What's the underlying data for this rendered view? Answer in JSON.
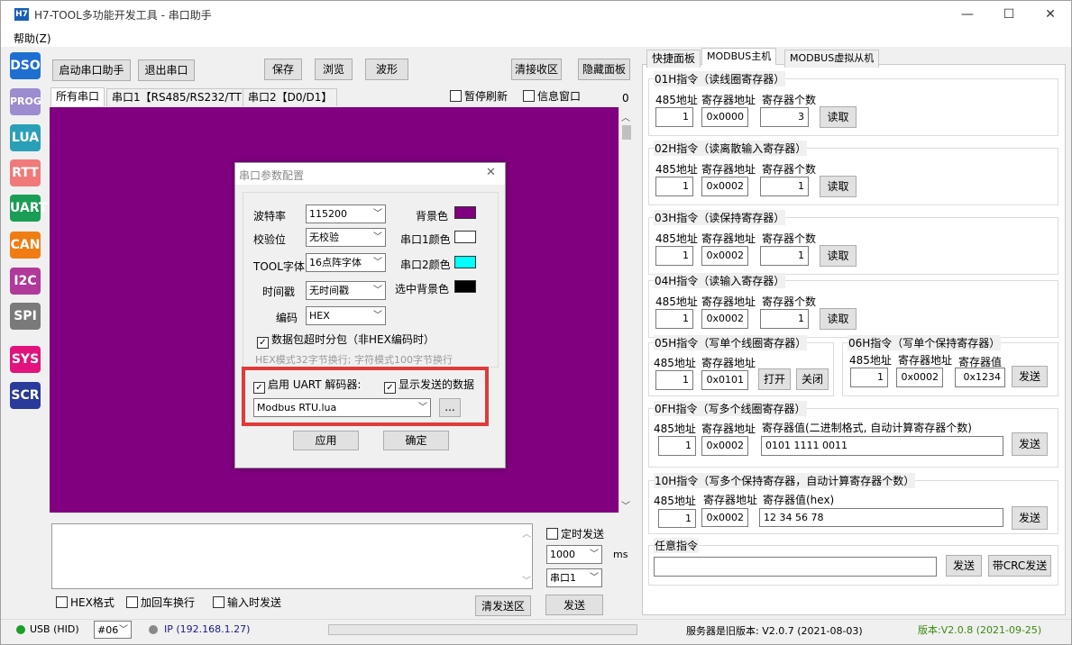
{
  "window": {
    "app_icon": "H7",
    "title": "H7-TOOL多功能开发工具 - 串口助手",
    "minimize": "—",
    "maximize": "☐",
    "close": "✕"
  },
  "menu": {
    "help": "帮助(Z)"
  },
  "sidebar": [
    {
      "label": "DSO",
      "color": "#1f6fd1"
    },
    {
      "label": "PROG",
      "color": "#9d8ccf"
    },
    {
      "label": "LUA",
      "color": "#2aa0b8"
    },
    {
      "label": "RTT",
      "color": "#f07a7a"
    },
    {
      "label": "UART",
      "color": "#1a9e55"
    },
    {
      "label": "CAN",
      "color": "#f07d14"
    },
    {
      "label": "I2C",
      "color": "#b03a9a"
    },
    {
      "label": "SPI",
      "color": "#7a7a7a"
    },
    {
      "label": "SYS",
      "color": "#e0147c"
    },
    {
      "label": "SCR",
      "color": "#2a3a9a"
    }
  ],
  "toolbar": {
    "start": "启动串口助手",
    "exit": "退出串口",
    "save": "保存",
    "browse": "浏览",
    "wave": "波形",
    "clear_recv": "清接收区",
    "hide_panel": "隐藏面板"
  },
  "serial_tabs": [
    "所有串口",
    "串口1【RS485/RS232/TTL】",
    "串口2【D0/D1】"
  ],
  "pause_refresh": "暂停刷新",
  "info_window": "信息窗口",
  "recv_count": "0",
  "colors": {
    "bg": "#800080",
    "port1": "#ffffff",
    "port2": "#00ffff",
    "sel_bg": "#000000"
  },
  "dialog": {
    "title": "串口参数配置",
    "close": "✕",
    "baud_label": "波特率",
    "baud": "115200",
    "parity_label": "校验位",
    "parity": "无校验",
    "font_label": "TOOL字体",
    "font": "16点阵字体",
    "timestamp_label": "时间戳",
    "timestamp": "无时间戳",
    "encoding_label": "编码",
    "encoding": "HEX",
    "bg_label": "背景色",
    "port1_label": "串口1颜色",
    "port2_label": "串口2颜色",
    "selbg_label": "选中背景色",
    "packet_split": "数据包超时分包（非HEX编码时）",
    "hint": "HEX模式32字节换行; 字符模式100字节换行",
    "uart_decoder": "启用 UART 解码器:",
    "show_sent": "显示发送的数据",
    "decoder_file": "Modbus RTU.lua",
    "browse": "...",
    "apply": "应用",
    "ok": "确定"
  },
  "send_area": {
    "timed_send": "定时发送",
    "interval": "1000",
    "unit": "ms",
    "port": "串口1",
    "hex_format": "HEX格式",
    "add_crlf": "加回车换行",
    "send_on_input": "输入时发送",
    "clear_send": "清发送区",
    "send": "发送"
  },
  "right_tabs": [
    "快捷面板",
    "MODBUS主机",
    "MODBUS虚拟从机"
  ],
  "modbus": {
    "addr": "485地址",
    "reg_addr": "寄存器地址",
    "reg_count": "寄存器个数",
    "reg_val": "寄存器值",
    "read": "读取",
    "send": "发送",
    "open": "打开",
    "close": "关闭",
    "g01": {
      "title": "01H指令（读线圈寄存器）",
      "a": "1",
      "r": "0x0000",
      "c": "3"
    },
    "g02": {
      "title": "02H指令（读离散输入寄存器）",
      "a": "1",
      "r": "0x0002",
      "c": "1"
    },
    "g03": {
      "title": "03H指令（读保持寄存器）",
      "a": "1",
      "r": "0x0002",
      "c": "1"
    },
    "g04": {
      "title": "04H指令（读输入寄存器）",
      "a": "1",
      "r": "0x0002",
      "c": "1"
    },
    "g05": {
      "title": "05H指令（写单个线圈寄存器）",
      "a": "1",
      "r": "0x0101"
    },
    "g06": {
      "title": "06H指令（写单个保持寄存器）",
      "a": "1",
      "r": "0x0002",
      "v": "0x1234"
    },
    "g0f": {
      "title": "0FH指令（写多个线圈寄存器）",
      "a": "1",
      "r": "0x0002",
      "vlabel": "寄存器值(二进制格式, 自动计算寄存器个数)",
      "v": "0101 1111 0011"
    },
    "g10": {
      "title": "10H指令（写多个保持寄存器，自动计算寄存器个数）",
      "a": "1",
      "r": "0x0002",
      "vlabel": "寄存器值(hex)",
      "v": "12 34 56 78"
    },
    "any": {
      "title": "任意指令",
      "send": "发送",
      "crc_send": "带CRC发送"
    }
  },
  "statusbar": {
    "usb": "USB (HID)",
    "dev": "#06",
    "ip": "IP (192.168.1.27)",
    "server": "服务器是旧版本: V2.0.7 (2021-08-03)",
    "version": "版本:V2.0.8 (2021-09-25)"
  }
}
